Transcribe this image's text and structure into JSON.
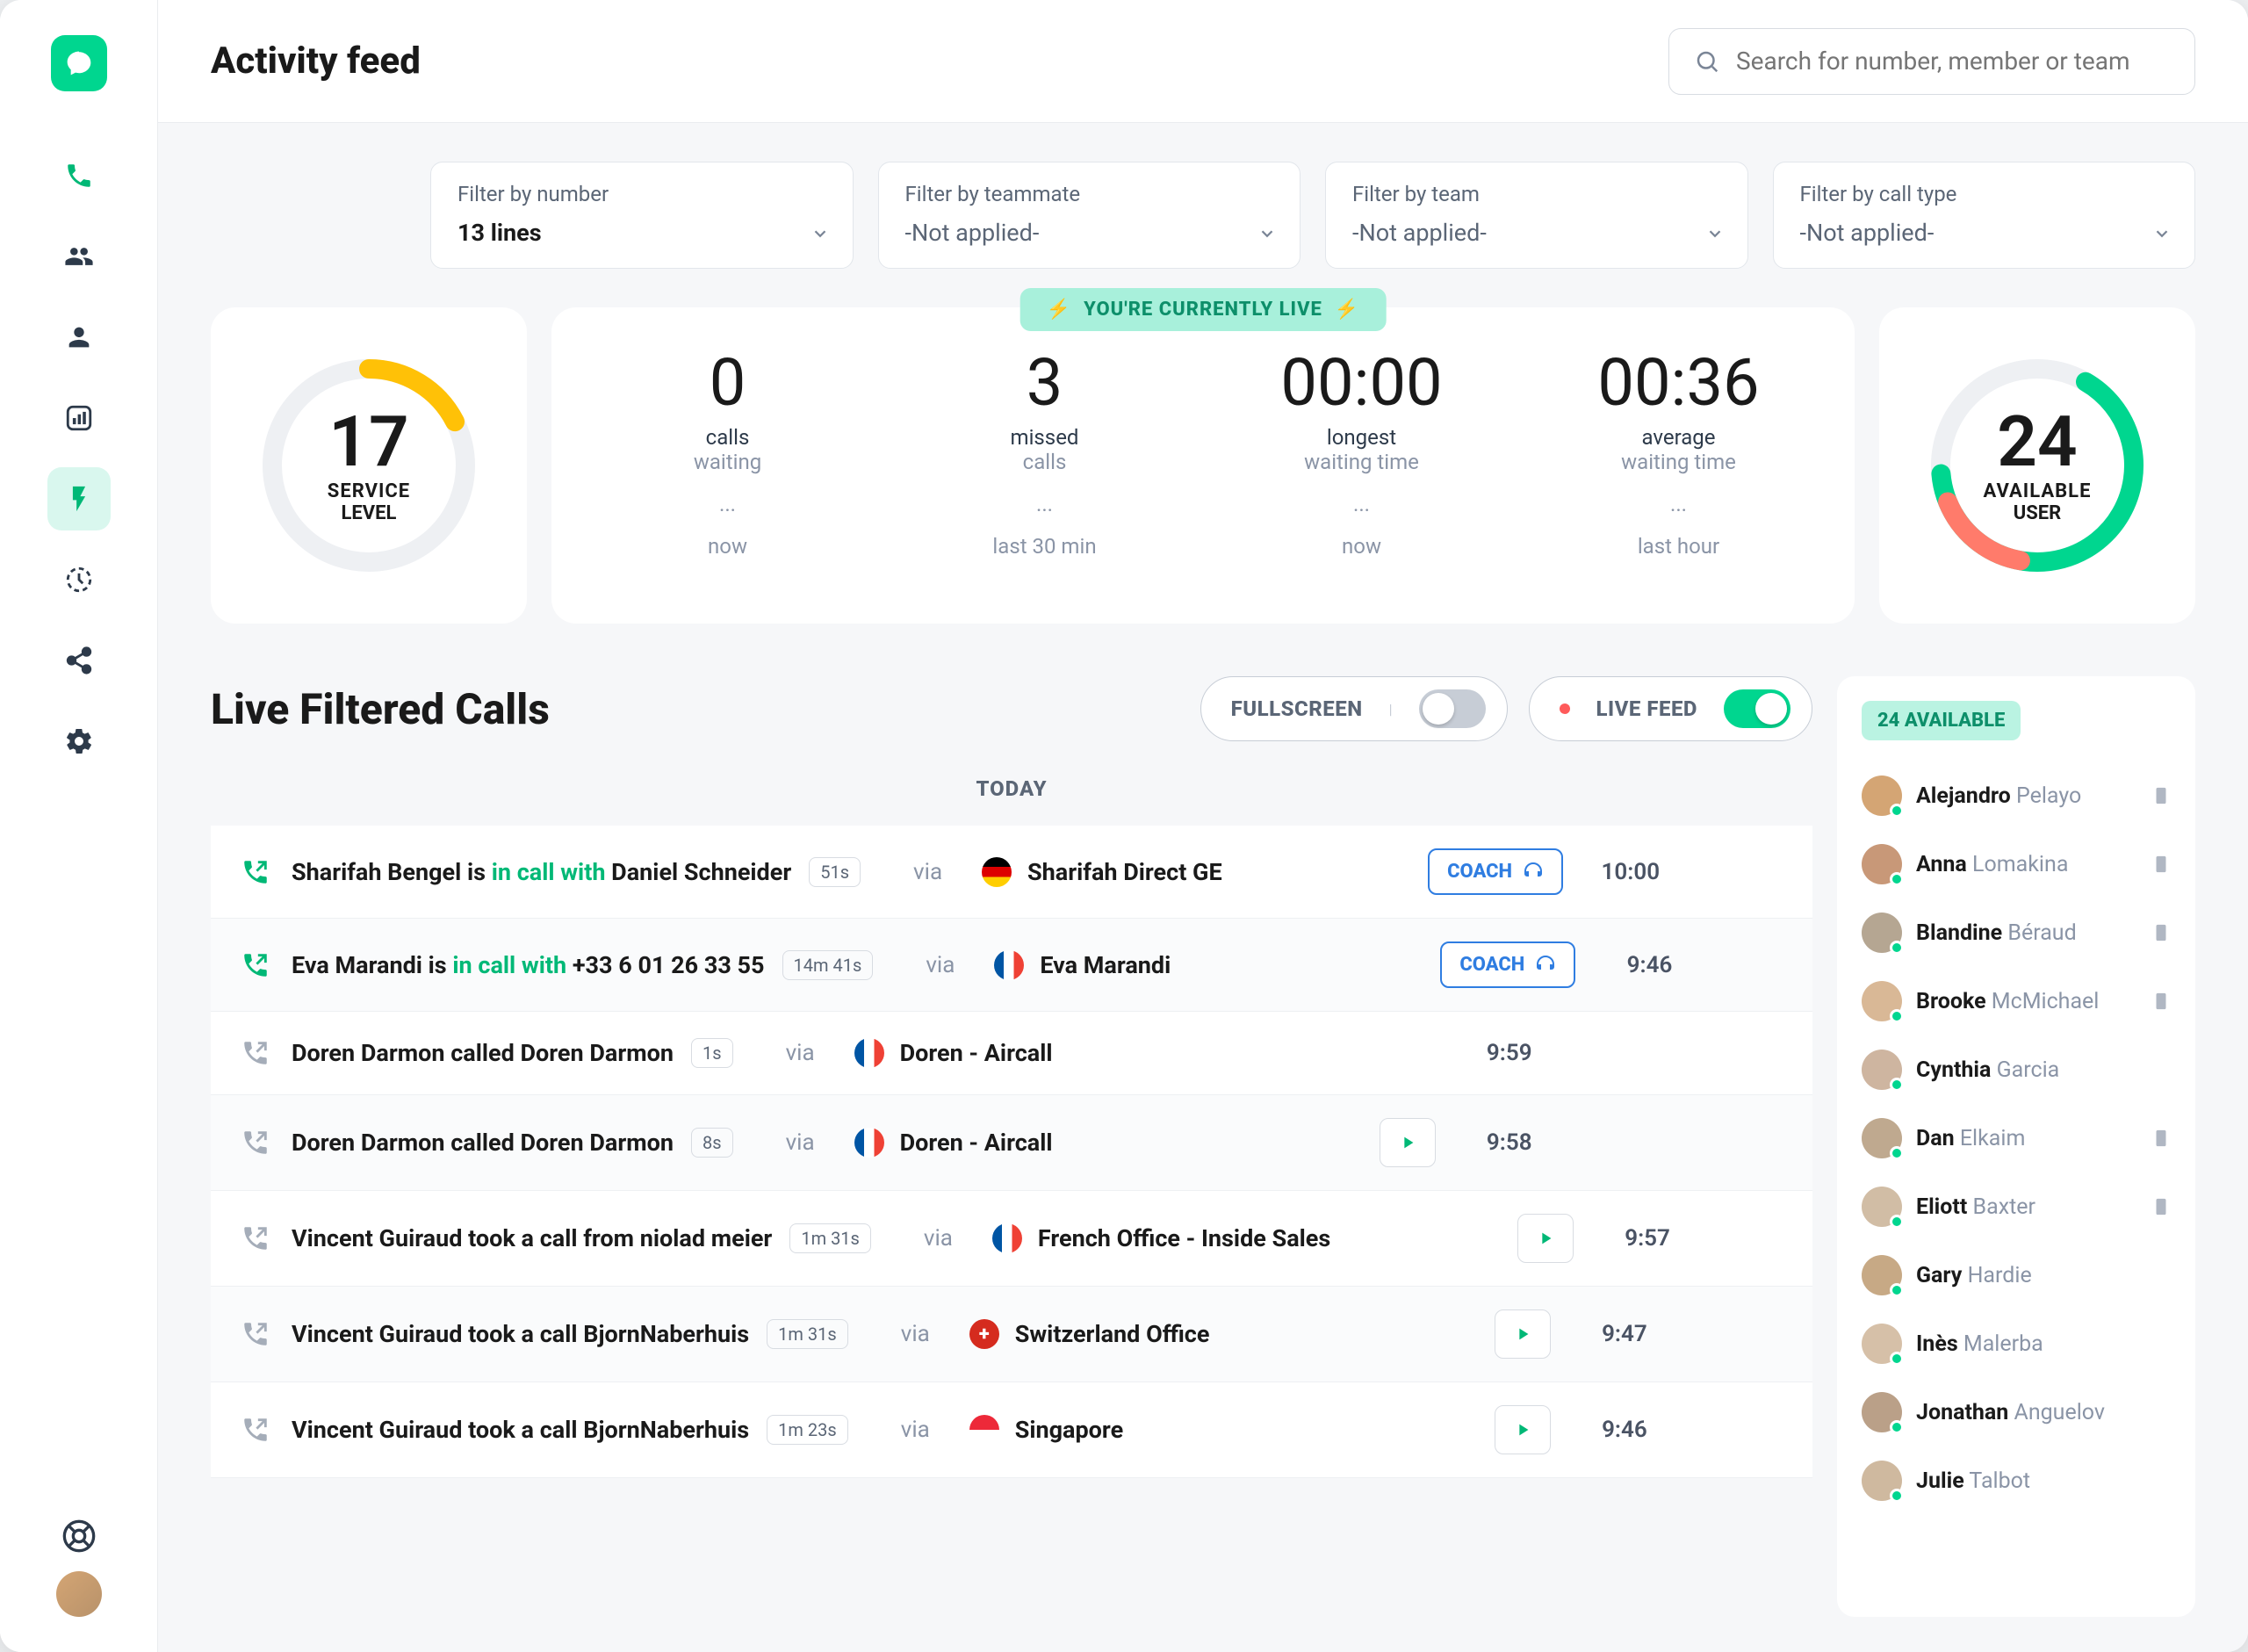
{
  "header": {
    "title": "Activity feed"
  },
  "search": {
    "placeholder": "Search for number, member or team"
  },
  "filters": [
    {
      "label": "Filter by number",
      "value": "13 lines",
      "bold": true
    },
    {
      "label": "Filter by teammate",
      "value": "-Not applied-",
      "bold": false
    },
    {
      "label": "Filter by team",
      "value": "-Not applied-",
      "bold": false
    },
    {
      "label": "Filter by call type",
      "value": "-Not applied-",
      "bold": false
    }
  ],
  "live_banner": "YOU'RE CURRENTLY LIVE",
  "gauges": {
    "service_level": {
      "value": "17",
      "l1": "SERVICE",
      "l2": "LEVEL"
    },
    "available_user": {
      "value": "24",
      "l1": "AVAILABLE",
      "l2": "USER"
    }
  },
  "stats": [
    {
      "big": "0",
      "l1": "calls",
      "l2": "waiting",
      "dots": "...",
      "period": "now"
    },
    {
      "big": "3",
      "l1": "missed",
      "l2": "calls",
      "dots": "...",
      "period": "last 30 min"
    },
    {
      "big": "00:00",
      "l1": "longest",
      "l2": "waiting time",
      "dots": "...",
      "period": "now"
    },
    {
      "big": "00:36",
      "l1": "average",
      "l2": "waiting time",
      "dots": "...",
      "period": "last hour"
    }
  ],
  "feed": {
    "title": "Live Filtered Calls",
    "fullscreen_label": "FULLSCREEN",
    "livefeed_label": "LIVE FEED",
    "today_label": "TODAY",
    "coach_label": "COACH",
    "calls": [
      {
        "active": true,
        "prefix": "Sharifah Bengel is ",
        "status": "in call with ",
        "suffix": "Daniel Schneider",
        "duration": "51s",
        "via": "via",
        "flag": "de",
        "office": "Sharifah Direct GE",
        "action": "coach",
        "time": "10:00"
      },
      {
        "active": true,
        "prefix": "Eva Marandi is ",
        "status": "in call with ",
        "suffix": "+33 6 01 26 33 55",
        "duration": "14m 41s",
        "via": "via",
        "flag": "fr",
        "office": "Eva Marandi",
        "action": "coach",
        "time": "9:46"
      },
      {
        "active": false,
        "prefix": "Doren Darmon called  Doren Darmon",
        "status": "",
        "suffix": "",
        "duration": "1s",
        "via": "via",
        "flag": "fr",
        "office": "Doren - Aircall",
        "action": "none",
        "time": "9:59"
      },
      {
        "active": false,
        "prefix": "Doren Darmon called  Doren Darmon",
        "status": "",
        "suffix": "",
        "duration": "8s",
        "via": "via",
        "flag": "fr",
        "office": "Doren - Aircall",
        "action": "play",
        "time": "9:58"
      },
      {
        "active": false,
        "prefix": "Vincent Guiraud took a call from niolad meier",
        "status": "",
        "suffix": "",
        "duration": "1m 31s",
        "via": "via",
        "flag": "fr",
        "office": "French Office - Inside Sales",
        "action": "play",
        "time": "9:57"
      },
      {
        "active": false,
        "prefix": "Vincent Guiraud took a call BjornNaberhuis",
        "status": "",
        "suffix": "",
        "duration": "1m 31s",
        "via": "via",
        "flag": "ch",
        "office": "Switzerland Office",
        "action": "play",
        "time": "9:47"
      },
      {
        "active": false,
        "prefix": "Vincent Guiraud took a call BjornNaberhuis",
        "status": "",
        "suffix": "",
        "duration": "1m 23s",
        "via": "via",
        "flag": "sg",
        "office": "Singapore",
        "action": "play",
        "time": "9:46"
      }
    ]
  },
  "available": {
    "badge": "24 AVAILABLE",
    "users": [
      {
        "first": "Alejandro",
        "last": "Pelayo",
        "device": true
      },
      {
        "first": "Anna",
        "last": "Lomakina",
        "device": true
      },
      {
        "first": "Blandine",
        "last": "Béraud",
        "device": true
      },
      {
        "first": "Brooke",
        "last": "McMichael",
        "device": true
      },
      {
        "first": "Cynthia",
        "last": "Garcia",
        "device": false
      },
      {
        "first": "Dan",
        "last": "Elkaim",
        "device": true
      },
      {
        "first": "Eliott",
        "last": "Baxter",
        "device": true
      },
      {
        "first": "Gary",
        "last": "Hardie",
        "device": false
      },
      {
        "first": "Inès",
        "last": "Malerba",
        "device": false
      },
      {
        "first": "Jonathan",
        "last": "Anguelov",
        "device": false
      },
      {
        "first": "Julie",
        "last": "Talbot",
        "device": false
      }
    ]
  },
  "flags": {
    "de": "linear-gradient(to bottom, #000 33%, #dd0000 33%, #dd0000 66%, #ffce00 66%)",
    "fr": "linear-gradient(to right, #0055a4 33%, #fff 33%, #fff 66%, #ef4135 66%)",
    "ch": "#d52b1e",
    "sg": "linear-gradient(to bottom, #ed2939 50%, #fff 50%)"
  },
  "avatar_colors": [
    "#d4a574",
    "#c89878",
    "#b5a692",
    "#d9b896",
    "#ceb5a0",
    "#bfa98f",
    "#d1bda5",
    "#c7a985",
    "#d6c0a8",
    "#baa088",
    "#cfb99f"
  ]
}
